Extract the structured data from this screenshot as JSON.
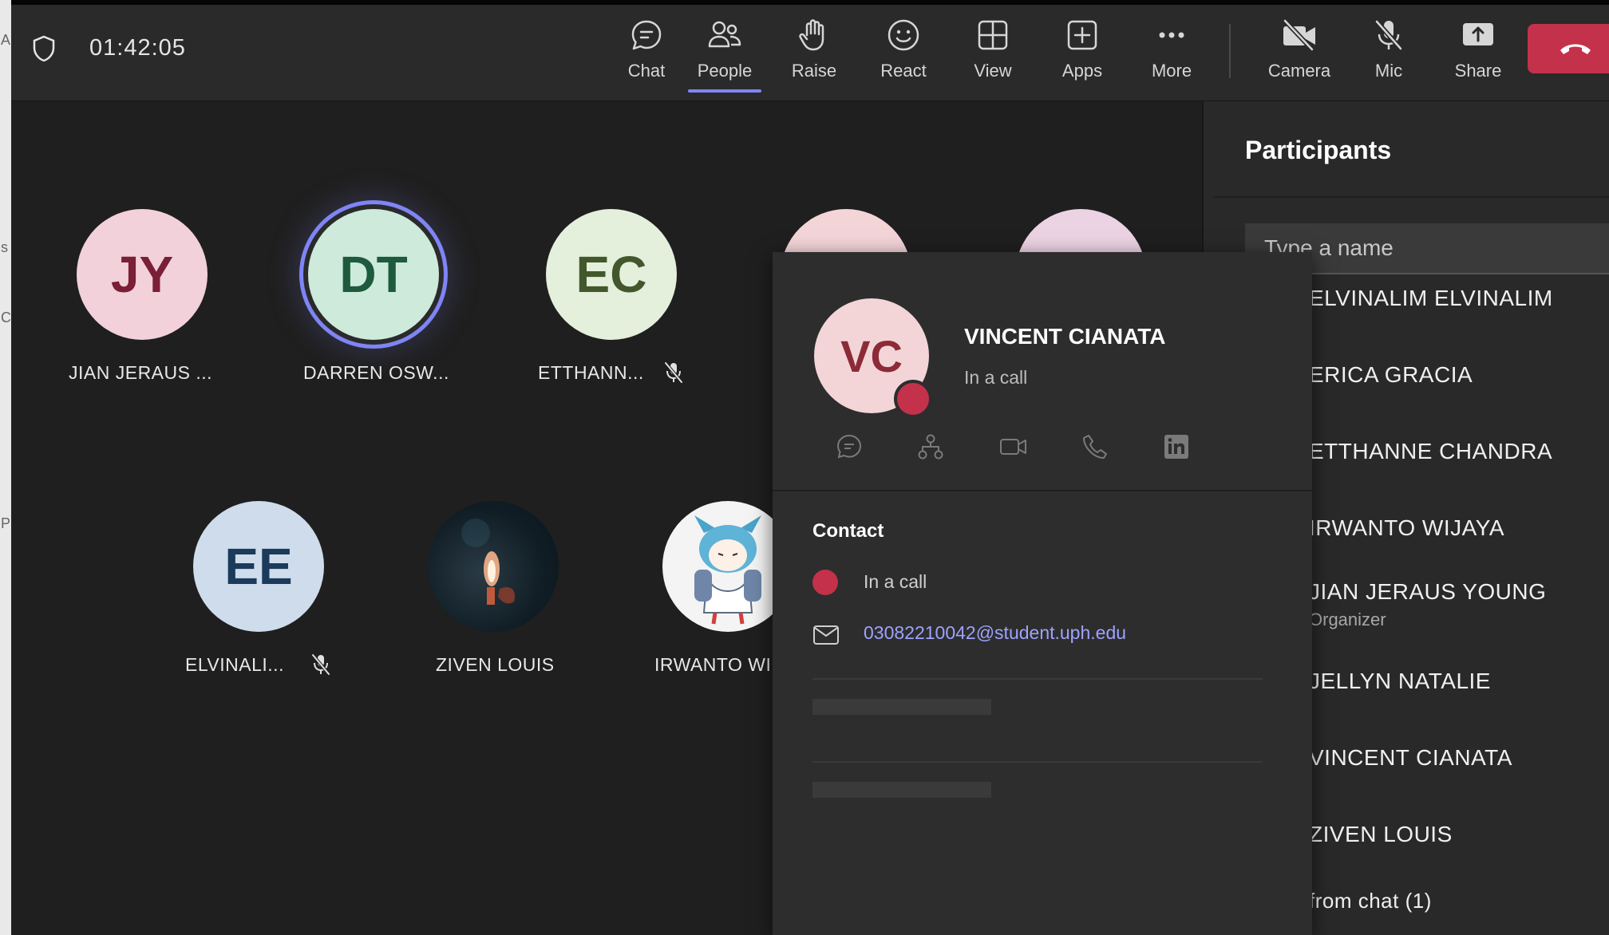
{
  "meeting": {
    "timer": "01:42:05"
  },
  "toolbar": {
    "chat_label": "Chat",
    "people_label": "People",
    "raise_label": "Raise",
    "react_label": "React",
    "view_label": "View",
    "apps_label": "Apps",
    "more_label": "More",
    "camera_label": "Camera",
    "mic_label": "Mic",
    "share_label": "Share",
    "active_tab": "People",
    "accent_color": "#7f85f5",
    "hangup_color": "#c4314b"
  },
  "stage": {
    "tiles": [
      {
        "initials": "JY",
        "name": "JIAN JERAUS ...",
        "bg": "#f2d1db",
        "fg": "#7a1f36",
        "muted": false,
        "speaking": false
      },
      {
        "initials": "DT",
        "name": "DARREN OSW...",
        "bg": "#cdeadb",
        "fg": "#1e5a3c",
        "muted": false,
        "speaking": true
      },
      {
        "initials": "EC",
        "name": "ETTHANN...",
        "bg": "#e4efdc",
        "fg": "#43572c",
        "muted": true,
        "speaking": false
      },
      {
        "initials": "",
        "name": "",
        "bg": "#f3d5d8",
        "fg": "#8c2a37",
        "muted": false,
        "speaking": false
      },
      {
        "initials": "",
        "name": "",
        "bg": "#ecd3e4",
        "fg": "#6c2a58",
        "muted": false,
        "speaking": false
      },
      {
        "initials": "EE",
        "name": "ELVINALI...",
        "bg": "#cfdcec",
        "fg": "#1c3a5c",
        "muted": true,
        "speaking": false
      },
      {
        "initials": "",
        "name": "ZIVEN LOUIS",
        "icon": "candle-photo-avatar",
        "muted": false,
        "speaking": false
      },
      {
        "initials": "",
        "name": "IRWANTO WI",
        "icon": "anime-character-avatar",
        "muted": false,
        "speaking": false
      }
    ]
  },
  "participants": {
    "title": "Participants",
    "search_placeholder": "Type a name",
    "items": [
      {
        "name": "ELVINALIM ELVINALIM"
      },
      {
        "name": "ERICA GRACIA"
      },
      {
        "name": "ETTHANNE CHANDRA"
      },
      {
        "name": "IRWANTO WIJAYA"
      },
      {
        "name": "JIAN JERAUS YOUNG",
        "role": "Organizer"
      },
      {
        "name": "JELLYN NATALIE"
      },
      {
        "name": "VINCENT CIANATA"
      },
      {
        "name": "ZIVEN LOUIS"
      },
      {
        "name": "from chat (1)"
      }
    ]
  },
  "contact_card": {
    "initials": "VC",
    "name": "VINCENT CIANATA",
    "status": "In a call",
    "presence_color": "#c4314b",
    "actions": [
      "chat-icon",
      "org-chart-icon",
      "video-icon",
      "phone-icon",
      "linkedin-icon"
    ],
    "section_title": "Contact",
    "contact_status": "In a call",
    "email": "03082210042@student.uph.edu"
  }
}
